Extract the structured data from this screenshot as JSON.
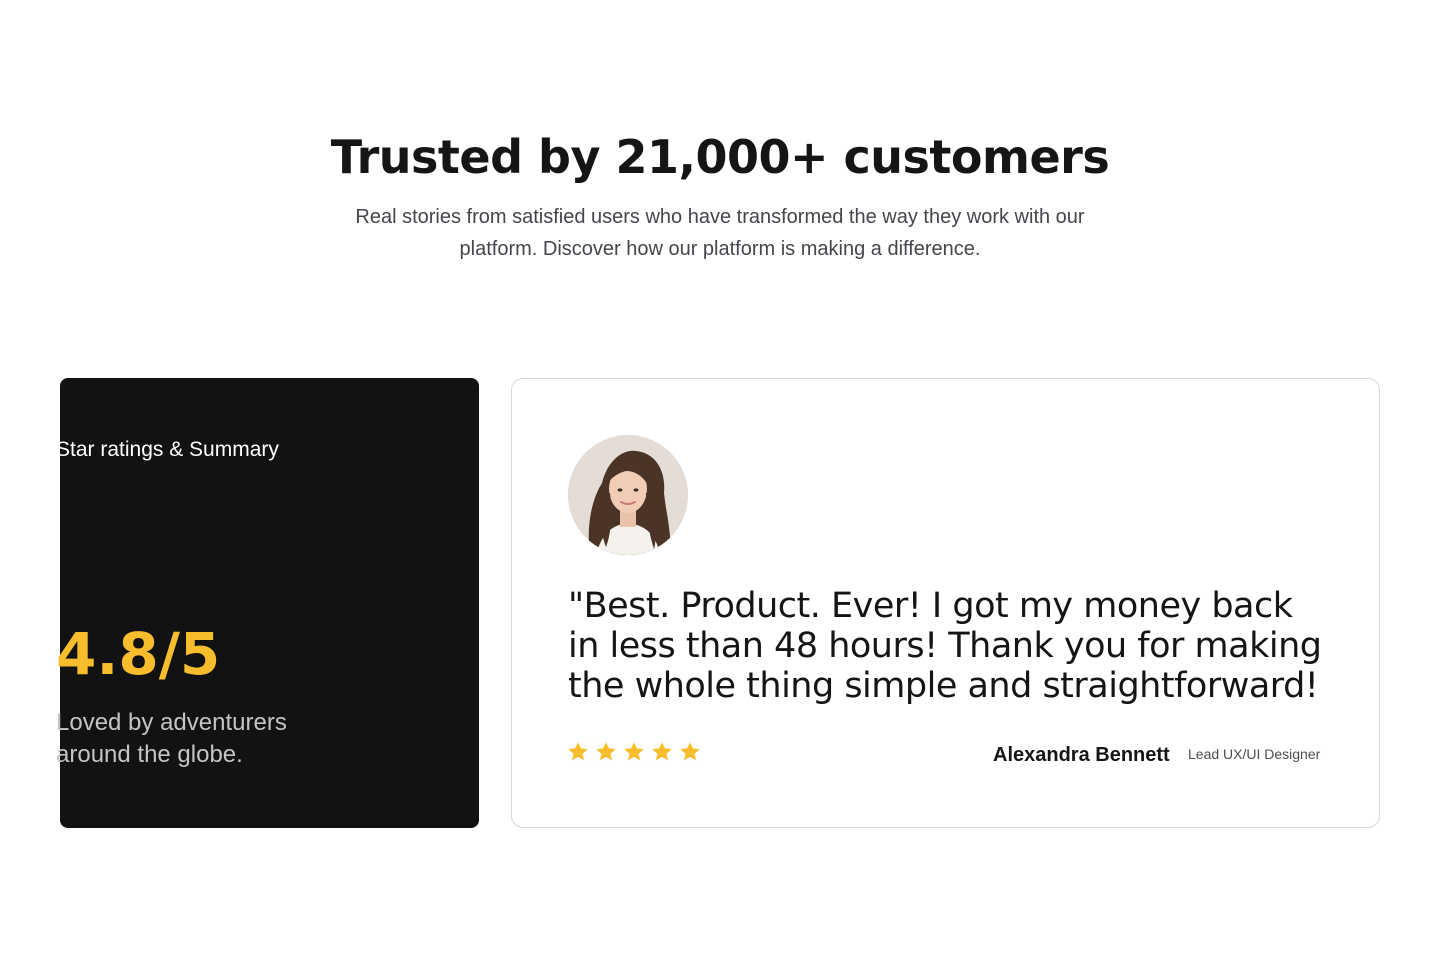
{
  "header": {
    "title": "Trusted by 21,000+ customers",
    "subtitle": "Real stories from satisfied users who have transformed the way they work with our platform. Discover how our platform is making a difference."
  },
  "summary": {
    "heading": "Star ratings & Summary",
    "score": "4.8/5",
    "caption": "Loved by adventurers around the globe."
  },
  "testimonial": {
    "quote": "\"Best. Product. Ever! I got my money back in less than 48 hours! Thank you for making the whole thing simple and straightforward!",
    "rating": 5,
    "max_rating": 5,
    "author": "Alexandra Bennett",
    "role": "Lead UX/UI Designer",
    "avatar_icon": "avatar-photo"
  },
  "colors": {
    "dark_card": "#121212",
    "accent_yellow": "#f7bd2c",
    "text_dark": "#151515",
    "border": "#d6d6d6"
  }
}
